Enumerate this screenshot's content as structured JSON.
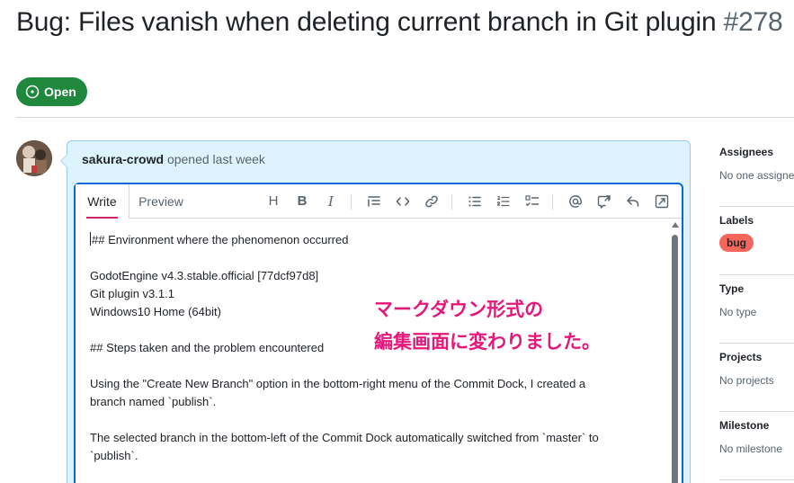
{
  "issue": {
    "title": "Bug: Files vanish when deleting current branch in Git plugin",
    "number": "#278",
    "state": "Open",
    "state_color": "#1f883d"
  },
  "comment": {
    "author": "sakura-crowd",
    "action": "opened last week"
  },
  "editor": {
    "tabs": [
      "Write",
      "Preview"
    ],
    "toolbar": {
      "heading": "H",
      "bold": "B",
      "italic": "I",
      "icons": [
        "quote-icon",
        "code-icon",
        "link-icon",
        "unordered-list-icon",
        "ordered-list-icon",
        "task-list-icon",
        "mention-icon",
        "cross-reference-icon",
        "reply-icon",
        "fullscreen-icon"
      ]
    },
    "lines": [
      "## Environment where the phenomenon occurred",
      "",
      "GodotEngine v4.3.stable.official [77dcf97d8]",
      "Git plugin v3.1.1",
      "Windows10 Home (64bit)",
      "",
      "## Steps taken and the problem encountered",
      "",
      "Using the \"Create New Branch\" option in the bottom-right menu of the Commit Dock, I created a",
      "branch named `publish`.",
      "",
      "The selected branch in the bottom-left of the Commit Dock automatically switched from `master` to",
      "`publish`."
    ]
  },
  "annotation": {
    "line1": "マークダウン形式の",
    "line2": "編集画面に変わりました。",
    "color": "#e6177a"
  },
  "sidebar": {
    "assignees": {
      "title": "Assignees",
      "value": "No one assigned"
    },
    "labels": {
      "title": "Labels",
      "value": "bug",
      "color": "#f4655c"
    },
    "type": {
      "title": "Type",
      "value": "No type"
    },
    "projects": {
      "title": "Projects",
      "value": "No projects"
    },
    "milestone": {
      "title": "Milestone",
      "value": "No milestone"
    }
  }
}
